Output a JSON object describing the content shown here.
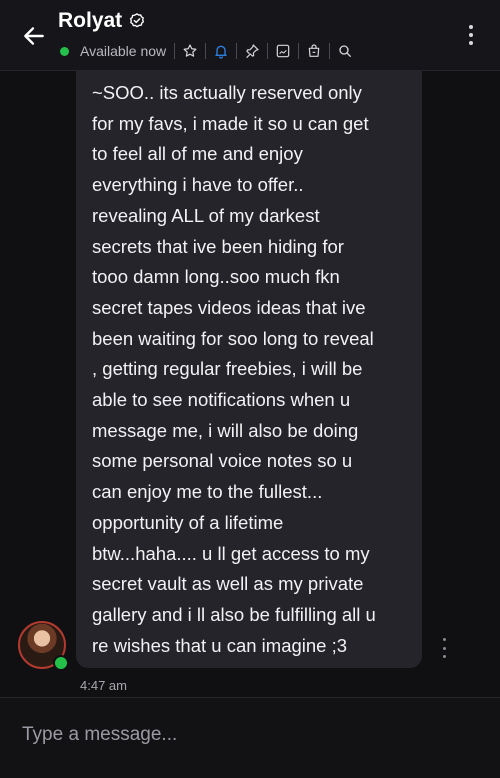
{
  "header": {
    "title": "Rolyat",
    "status": "Available now"
  },
  "message": {
    "text": "~SOO.. its actually reserved only\nfor my favs, i made it so u can get\nto feel all of me and enjoy\neverything i have to offer..\nrevealing ALL of my darkest\nsecrets that ive been hiding for\ntooo damn long..soo much fkn\nsecret tapes videos ideas that ive\nbeen waiting for soo long to reveal\n, getting regular freebies, i will be\nable to see notifications when u\nmessage me, i will also be doing\nsome personal voice notes so u\ncan enjoy me to the fullest...\nopportunity of a lifetime\nbtw...haha.... u ll get access to my\nsecret vault as well as my private\ngallery and i ll also be fulfilling all u\nre wishes that u can imagine ;3",
    "time": "4:47 am"
  },
  "composer": {
    "placeholder": "Type a message..."
  },
  "colors": {
    "background": "#101012",
    "bubble": "#24242a",
    "online": "#24c04a",
    "accent": "#2f7fe0"
  },
  "icons": [
    "back-arrow-icon",
    "verified-icon",
    "star-icon",
    "bell-icon",
    "pin-icon",
    "media-icon",
    "vault-icon",
    "search-icon",
    "more-vertical-icon"
  ]
}
